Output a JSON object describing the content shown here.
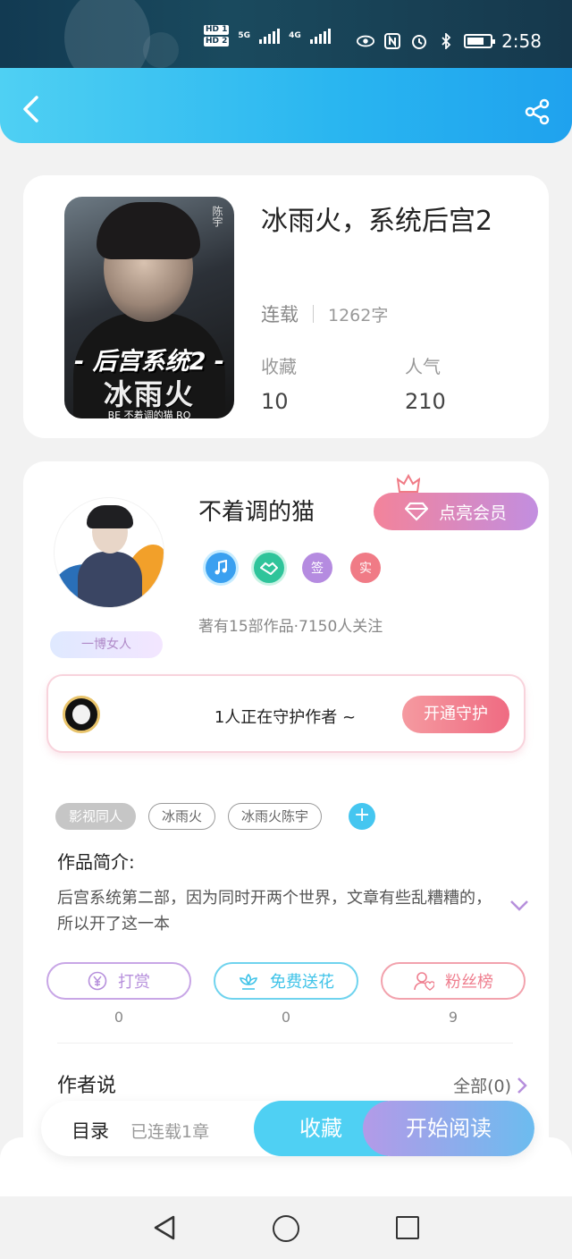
{
  "status_bar": {
    "hd1": "HD 1",
    "hd2": "HD 2",
    "net1": "5G",
    "net2": "4G",
    "time": "2:58"
  },
  "book": {
    "title": "冰雨火，系统后宫2",
    "serial_status": "连载",
    "word_count": "1262字",
    "collect_label": "收藏",
    "collect_value": "10",
    "popularity_label": "人气",
    "popularity_value": "210",
    "cover": {
      "vertical_text": "陈宇",
      "title_line1": "- 后宫系统2 -",
      "title_line2": "冰雨火",
      "author_line": "BE 不着调的猫 RO"
    }
  },
  "author": {
    "name": "不着调的猫",
    "vip_button": "点亮会员",
    "badges": [
      {
        "icon": "music-note-icon",
        "color": "#3aa0f0"
      },
      {
        "icon": "handshake-icon",
        "color": "#2fc49a"
      },
      {
        "label": "签",
        "color": "#b58be0"
      },
      {
        "label": "实",
        "color": "#f07b86"
      }
    ],
    "meta": "著有15部作品·7150人关注",
    "avatar_tag": "一博女人"
  },
  "guard": {
    "text": "1人正在守护作者 ~",
    "button": "开通守护"
  },
  "tags": [
    "影视同人",
    "冰雨火",
    "冰雨火陈宇"
  ],
  "intro": {
    "title": "作品简介:",
    "text": "后宫系统第二部，因为同时开两个世界，文章有些乱糟糟的，所以开了这一本"
  },
  "actions": [
    {
      "label": "打赏",
      "icon": "yen-coin-icon",
      "count": "0",
      "color": "#b68fdc"
    },
    {
      "label": "免费送花",
      "icon": "flower-icon",
      "count": "0",
      "color": "#3fc3e8"
    },
    {
      "label": "粉丝榜",
      "icon": "fan-user-icon",
      "count": "9",
      "color": "#ef7f8f"
    }
  ],
  "author_says": {
    "title": "作者说",
    "all_link": "全部(0)"
  },
  "bottom_bar": {
    "toc": "目录",
    "chapters": "已连载1章",
    "favorite": "收藏",
    "start_reading": "开始阅读"
  }
}
